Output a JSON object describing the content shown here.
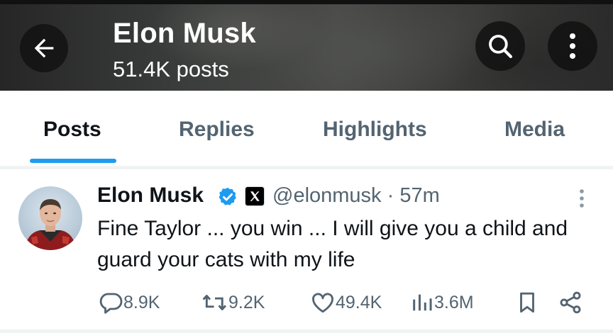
{
  "header": {
    "name": "Elon Musk",
    "post_count": "51.4K posts",
    "back_icon": "arrow-left-icon",
    "search_icon": "search-icon",
    "more_icon": "more-vertical-icon"
  },
  "tabs": [
    {
      "label": "Posts",
      "active": true
    },
    {
      "label": "Replies",
      "active": false
    },
    {
      "label": "Highlights",
      "active": false
    },
    {
      "label": "Media",
      "active": false
    }
  ],
  "tweet": {
    "author_name": "Elon Musk",
    "handle": "@elonmusk",
    "separator": "·",
    "time": "57m",
    "text": "Fine Taylor ... you win ... I will give you a child and guard your cats with my life",
    "stats": {
      "replies": "8.9K",
      "reposts": "9.2K",
      "likes": "49.4K",
      "views": "3.6M"
    }
  },
  "colors": {
    "accent": "#1d9bf0",
    "text_primary": "#0f1419",
    "text_secondary": "#536471",
    "divider": "#eff3f4"
  }
}
